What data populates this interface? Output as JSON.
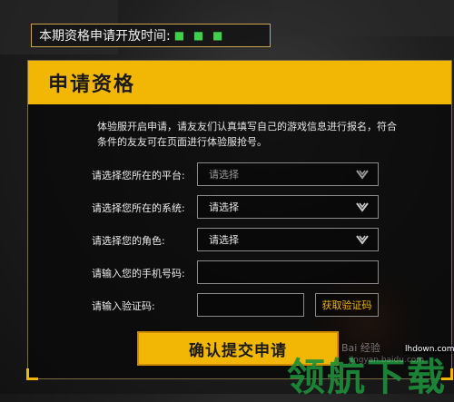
{
  "header": {
    "label": "本期资格申请开放时间:",
    "value_redacted": "■ ■ ■"
  },
  "panel": {
    "title": "申请资格",
    "intro": "体验服开启申请，请友友们认真填写自己的游戏信息进行报名，符合条件的友友可在页面进行体验服抢号。"
  },
  "form": {
    "platform": {
      "label": "请选择您所在的平台:",
      "value": "请选择"
    },
    "system": {
      "label": "请选择您所在的系统:",
      "value": "请选择"
    },
    "role": {
      "label": "请选择您的角色:",
      "value": "请选择"
    },
    "phone": {
      "label": "请输入您的手机号码:",
      "value": ""
    },
    "code": {
      "label": "请输入验证码:",
      "value": "",
      "button": "获取验证码"
    }
  },
  "submit": {
    "label": "确认提交申请"
  },
  "watermark": {
    "text1": "Bai 经验",
    "text2": "jingyan.baidu.com",
    "text3": "lhdown.com",
    "text4": "领航下载"
  },
  "colors": {
    "accent": "#f2b705",
    "panel_bg": "#0a0a0a",
    "field_border": "#8a8a8a"
  }
}
